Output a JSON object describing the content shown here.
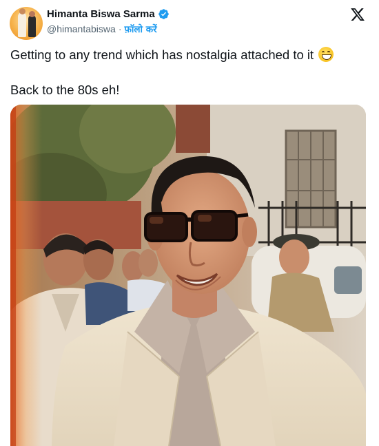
{
  "author": {
    "display_name": "Himanta Biswa Sarma",
    "handle": "@himantabiswa",
    "separator": "·",
    "follow_label": "फ़ॉलो करें",
    "verified": true,
    "avatar_icon": "profile-avatar"
  },
  "tweet": {
    "line1": "Getting to any trend which has nostalgia attached to it",
    "emoji": "grinning-face-with-smiling-eyes",
    "line2": "Back to the 80s eh!"
  },
  "icons": {
    "brand": "x-logo-icon",
    "verified": "verified-badge-icon"
  },
  "colors": {
    "accent": "#1d9bf0",
    "text": "#0f1419",
    "secondary": "#536471"
  },
  "media": {
    "type": "photo"
  }
}
